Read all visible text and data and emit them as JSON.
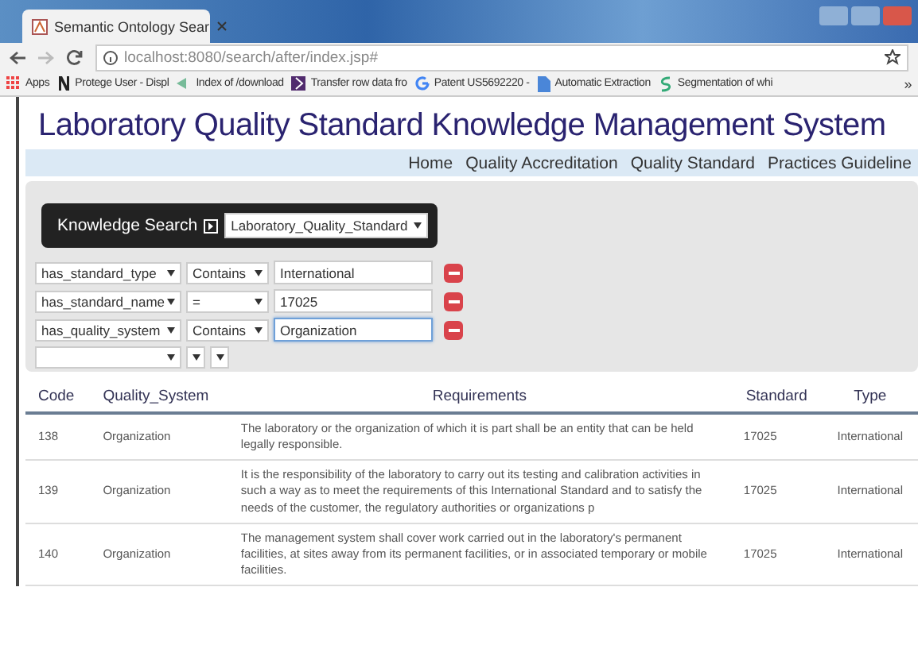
{
  "browser": {
    "tab_title": "Semantic Ontology Sear",
    "url": "localhost:8080/search/after/index.jsp#",
    "bookmarks": [
      {
        "label": "Apps",
        "kind": "apps"
      },
      {
        "label": "Protege User - Displ",
        "kind": "n"
      },
      {
        "label": "Index of /download",
        "kind": "arrow"
      },
      {
        "label": "Transfer row data fro",
        "kind": "chevron"
      },
      {
        "label": "Patent US5692220 -",
        "kind": "g"
      },
      {
        "label": "Automatic Extraction",
        "kind": "doc"
      },
      {
        "label": "Segmentation of whi",
        "kind": "swirl"
      }
    ],
    "more": "»"
  },
  "title": "Laboratory Quality Standard Knowledge Management System",
  "nav": [
    "Home",
    "Quality Accreditation",
    "Quality Standard",
    "Practices Guideline"
  ],
  "search": {
    "label": "Knowledge Search",
    "ontology": "Laboratory_Quality_Standard",
    "filters": [
      {
        "kind": "filter",
        "property": "has_standard_type",
        "operator": "Contains",
        "value": "International",
        "focused": false
      },
      {
        "kind": "filter",
        "property": "has_standard_name",
        "operator": "=",
        "value": "17025",
        "focused": false
      },
      {
        "kind": "filter",
        "property": "has_quality_system",
        "operator": "Contains",
        "value": "Organization",
        "focused": true
      },
      {
        "kind": "blank"
      }
    ]
  },
  "table": {
    "columns": [
      "Code",
      "Quality_System",
      "Requirements",
      "Standard",
      "Type"
    ],
    "rows": [
      [
        "138",
        "Organization",
        "The laboratory or the organization of which it is part shall be an entity that can be held legally responsible.",
        "17025",
        "International"
      ],
      [
        "139",
        "Organization",
        "It is the responsibility of the laboratory to carry out its testing and calibration activities in such a way as to meet the requirements of this International Standard and to satisfy the needs of the customer, the regulatory authorities or organizations p",
        "17025",
        "International"
      ],
      [
        "140",
        "Organization",
        "The management system shall cover work carried out in the laboratory's permanent facilities, at sites away from its permanent facilities, or in associated temporary or mobile facilities.",
        "17025",
        "International"
      ]
    ]
  }
}
